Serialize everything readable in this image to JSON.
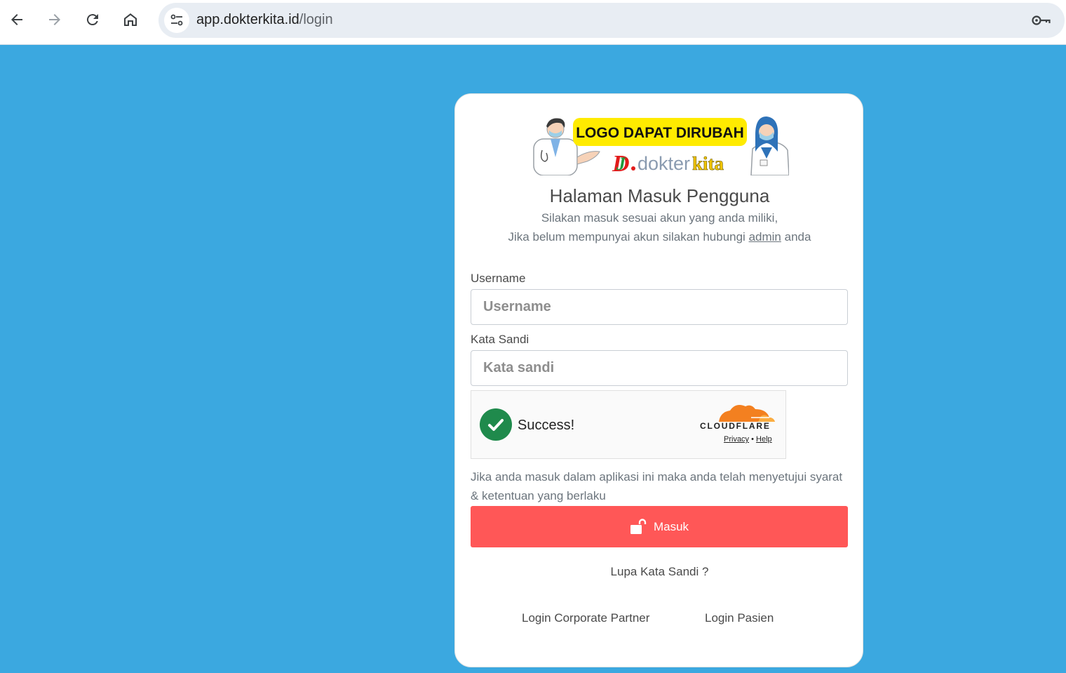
{
  "browser": {
    "url_host": "app.dokterkita.id",
    "url_path": "/login"
  },
  "logo": {
    "banner_text": "LOGO DAPAT DIRUBAH",
    "brand_left": "dokter",
    "brand_right": "kita"
  },
  "login": {
    "title": "Halaman Masuk Pengguna",
    "subtitle_line1": "Silakan masuk sesuai akun yang anda miliki,",
    "subtitle_line2_before": "Jika belum mempunyai akun silakan hubungi",
    "subtitle_link": "admin",
    "subtitle_line2_after": "anda",
    "username_label": "Username",
    "username_placeholder": "Username",
    "username_value": "",
    "password_label": "Kata Sandi",
    "password_placeholder": "Kata sandi",
    "password_value": "",
    "terms": "Jika anda masuk dalam aplikasi ini maka anda telah menyetujui syarat & ketentuan yang berlaku",
    "submit_label": "Masuk",
    "forgot_label": "Lupa Kata Sandi ?",
    "corporate_label": "Login Corporate Partner",
    "patient_label": "Login Pasien"
  },
  "captcha": {
    "status": "Success!",
    "provider": "CLOUDFLARE",
    "privacy": "Privacy",
    "separator": "•",
    "help": "Help"
  },
  "colors": {
    "background": "#3ba8e0",
    "submit": "#ff5757",
    "captcha_success": "#1f8a4c",
    "cloudflare_orange": "#f38020",
    "logo_banner": "#ffeb00"
  }
}
